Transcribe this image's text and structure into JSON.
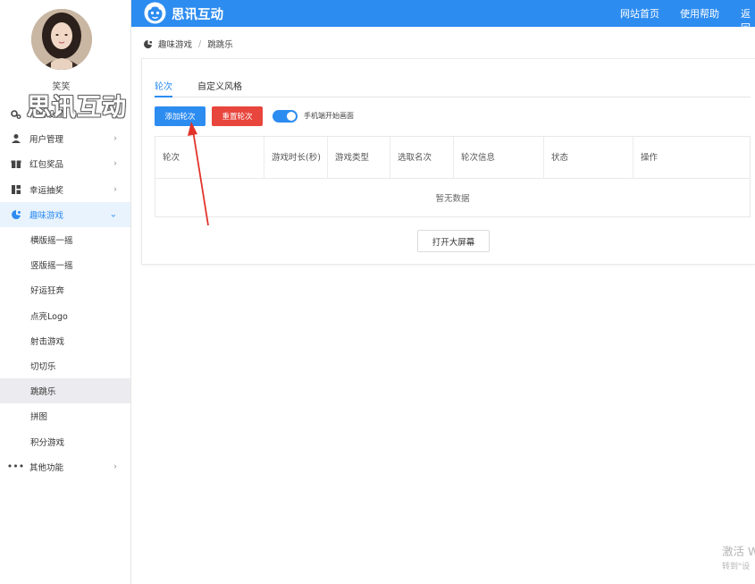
{
  "user": {
    "name": "笑笑"
  },
  "watermark": "思讯互动",
  "sidebar": {
    "items": [
      {
        "label": "活动设置",
        "icon": "gears-icon"
      },
      {
        "label": "用户管理",
        "icon": "user-icon"
      },
      {
        "label": "红包奖品",
        "icon": "gift-icon"
      },
      {
        "label": "幸运抽奖",
        "icon": "lottery-icon"
      },
      {
        "label": "趣味游戏",
        "icon": "game-icon"
      },
      {
        "label": "其他功能",
        "icon": "more-icon"
      }
    ],
    "submenu": [
      "横版摇一摇",
      "竖版摇一摇",
      "好运狂奔",
      "点亮Logo",
      "射击游戏",
      "切切乐",
      "跳跳乐",
      "拼图",
      "积分游戏"
    ]
  },
  "topbar": {
    "brand": "思讯互动",
    "nav": [
      "网站首页",
      "使用帮助",
      "返回"
    ],
    "color": "#2d8cf0"
  },
  "breadcrumb": {
    "parent": "趣味游戏",
    "sep": "/",
    "current": "跳跳乐"
  },
  "tabs": [
    "轮次",
    "自定义风格"
  ],
  "actions": {
    "add": "添加轮次",
    "reset": "重置轮次",
    "switch_label": "手机端开始画面",
    "switch_on": true
  },
  "table": {
    "headers": [
      "轮次",
      "游戏时长(秒)",
      "游戏类型",
      "选取名次",
      "轮次信息",
      "状态",
      "操作"
    ],
    "empty_text": "暂无数据"
  },
  "open_screen": "打开大屏幕",
  "os_notice": {
    "line1": "激活 W",
    "line2": "转到\"设"
  }
}
